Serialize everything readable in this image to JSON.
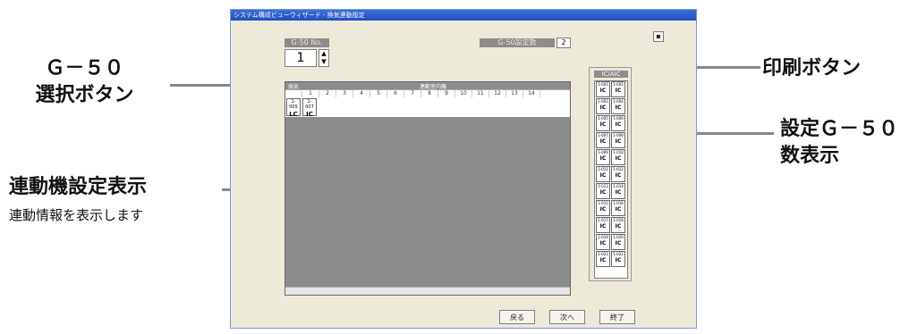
{
  "callouts": {
    "g50_select": [
      "Ｇ－５０",
      "選択ボタン"
    ],
    "print": "印刷ボタン",
    "setting_count": [
      "設定Ｇ－５０",
      "数表示"
    ],
    "linked_display": "連動機設定表示",
    "linked_display_sub": "連動情報を表示します"
  },
  "window": {
    "title": "システム構成ビューウィザード - 換気連動設定",
    "g50_no_label": "G-50 No.",
    "g50_no_value": "1",
    "setting_label": "G-50設定数",
    "setting_value": "2",
    "grid_left_header": "換気",
    "grid_header": "連動室内機",
    "col_numbers": [
      "1",
      "2",
      "3",
      "4",
      "5",
      "6",
      "7",
      "8",
      "9",
      "10",
      "11",
      "12",
      "13",
      "14"
    ],
    "row_units": [
      {
        "addr": "1-005",
        "type": "LC"
      },
      {
        "addr": "1-007",
        "type": "IC"
      }
    ],
    "ic_panel_title": "IC/AIC",
    "ic_units": [
      "1-001",
      "1-002",
      "1-003",
      "1-004",
      "1-005",
      "1-006",
      "1-007",
      "1-008",
      "1-009",
      "1-010",
      "1-011",
      "1-012",
      "1-013",
      "1-014",
      "1-015",
      "1-016",
      "1-017",
      "1-018",
      "1-019",
      "1-020",
      "1-021",
      "1-022"
    ],
    "ic_type": "IC",
    "buttons": {
      "back": "戻る",
      "next": "次へ",
      "finish": "終了"
    }
  }
}
